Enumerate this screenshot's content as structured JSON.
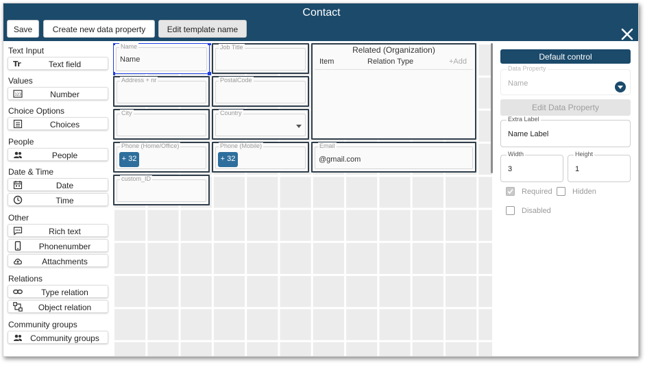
{
  "header": {
    "title": "Contact",
    "buttons": {
      "save": "Save",
      "create_property": "Create new data property",
      "edit_template": "Edit template name"
    },
    "close_icon": "close-icon",
    "colors": {
      "header_bg": "#1b4a6b",
      "accent": "#2d6e9c",
      "selection": "#1f3fe0"
    }
  },
  "sidebar": {
    "groups": [
      {
        "title": "Text Input",
        "items": [
          {
            "label": "Text field",
            "icon": "text-format-icon"
          }
        ]
      },
      {
        "title": "Values",
        "items": [
          {
            "label": "Number",
            "icon": "number-icon"
          }
        ]
      },
      {
        "title": "Choice Options",
        "items": [
          {
            "label": "Choices",
            "icon": "list-icon"
          }
        ]
      },
      {
        "title": "People",
        "items": [
          {
            "label": "People",
            "icon": "people-icon"
          }
        ]
      },
      {
        "title": "Date & Time",
        "items": [
          {
            "label": "Date",
            "icon": "calendar-icon"
          },
          {
            "label": "Time",
            "icon": "clock-icon"
          }
        ]
      },
      {
        "title": "Other",
        "items": [
          {
            "label": "Rich text",
            "icon": "comment-icon"
          },
          {
            "label": "Phonenumber",
            "icon": "phone-icon"
          },
          {
            "label": "Attachments",
            "icon": "cloud-upload-icon"
          }
        ]
      },
      {
        "title": "Relations",
        "items": [
          {
            "label": "Type relation",
            "icon": "link-icon"
          },
          {
            "label": "Object relation",
            "icon": "object-relation-icon"
          }
        ]
      },
      {
        "title": "Community groups",
        "items": [
          {
            "label": "Community groups",
            "icon": "people-icon"
          }
        ]
      }
    ]
  },
  "canvas": {
    "fields": {
      "name": {
        "label": "Name",
        "value": "Name"
      },
      "job_title": {
        "label": "Job Title"
      },
      "address": {
        "label": "Address + nr"
      },
      "postal_code": {
        "label": "PostalCode"
      },
      "city": {
        "label": "City"
      },
      "country": {
        "label": "Country"
      },
      "phone_home": {
        "label": "Phone (Home/Office)",
        "chip": "+ 32"
      },
      "phone_mobile": {
        "label": "Phone (Mobile)",
        "chip": "+ 32"
      },
      "email": {
        "label": "Email",
        "value": "@gmail.com"
      },
      "custom_id": {
        "label": "custom_ID"
      }
    },
    "related": {
      "title": "Related (Organization)",
      "col_item": "Item",
      "col_relation": "Relation Type",
      "add": "+Add"
    }
  },
  "panel": {
    "default_control": "Default control",
    "data_property": {
      "label": "Data Property",
      "value": "Name"
    },
    "edit_data_property": "Edit Data Property",
    "extra_label": {
      "label": "Extra Label",
      "value": "Name Label"
    },
    "width": {
      "label": "Width",
      "value": "3"
    },
    "height": {
      "label": "Height",
      "value": "1"
    },
    "required": {
      "label": "Required",
      "checked": true
    },
    "hidden": {
      "label": "Hidden",
      "checked": false
    },
    "disabled": {
      "label": "Disabled",
      "checked": false
    }
  }
}
